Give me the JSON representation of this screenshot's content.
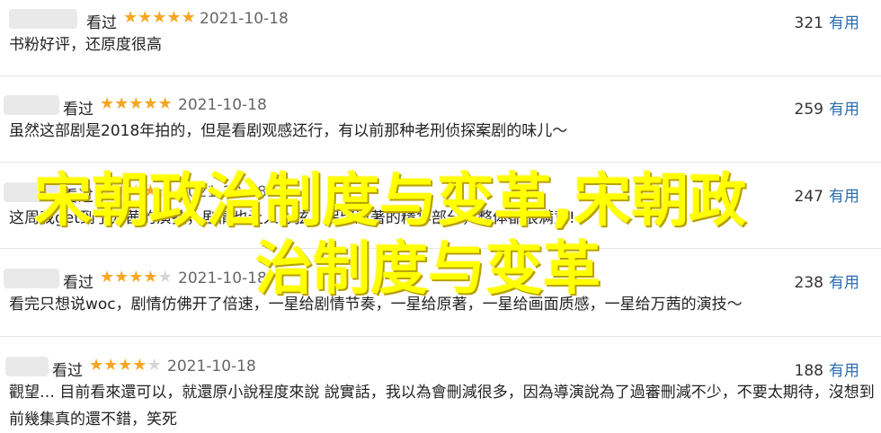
{
  "reviews": [
    {
      "status": "看过",
      "stars": 5,
      "date": "2021-10-18",
      "votes": "321",
      "useful": "有用",
      "text": "书粉好评，还原度很高"
    },
    {
      "status": "看过",
      "stars": 5,
      "date": "2021-10-18",
      "votes": "259",
      "useful": "有用",
      "text": "虽然这部剧是2018年拍的，但是看剧观感还行，有以前那种老刑侦探案剧的味儿～"
    },
    {
      "status": "看过",
      "stars": 4,
      "date": "2021-10-18",
      "votes": "247",
      "useful": "有用",
      "text": "这周我get到了万茜的演技，剧情也让人心弦，保留原著的精华部分，整体都很满意!"
    },
    {
      "status": "看过",
      "stars": 4,
      "date": "2021-10-18",
      "votes": "238",
      "useful": "有用",
      "text": "看完只想说woc，剧情仿佛开了倍速，一星给剧情节奏，一星给原著，一星给画面质感，一星给万茜的演技～"
    },
    {
      "status": "看过",
      "stars": 4,
      "date": "2021-10-18",
      "votes": "188",
      "useful": "有用",
      "text": "觀望… 目前看來還可以，就還原小說程度來說 說實話，我以為會刪減很多，因為導演說為了過審刪減不少，不要太期待，沒想到前幾集真的還不錯，笑死"
    }
  ],
  "overlay": {
    "line1": "宋朝政治制度与变革,宋朝政",
    "line2": "治制度与变革",
    "color": "#ffff00"
  },
  "colors": {
    "star": "#f6a623",
    "star_empty": "#d6d6d6",
    "link": "#2b6cb0"
  }
}
